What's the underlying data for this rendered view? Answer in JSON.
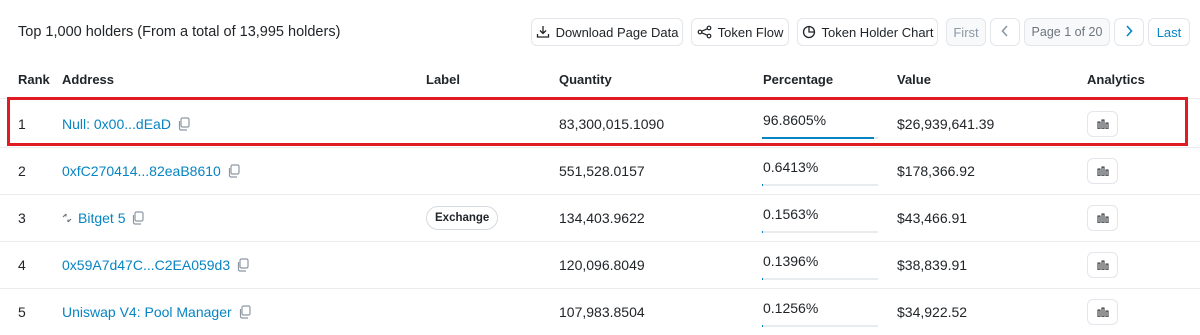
{
  "summary": "Top 1,000 holders (From a total of 13,995 holders)",
  "toolbar": {
    "download_label": "Download Page Data",
    "token_flow_label": "Token Flow",
    "holder_chart_label": "Token Holder Chart",
    "first_label": "First",
    "page_label": "Page 1 of 20",
    "last_label": "Last"
  },
  "columns": {
    "rank": "Rank",
    "address": "Address",
    "label": "Label",
    "quantity": "Quantity",
    "percentage": "Percentage",
    "value": "Value",
    "analytics": "Analytics"
  },
  "rows": [
    {
      "rank": "1",
      "address": "Null: 0x00...dEaD",
      "label": "",
      "quantity": "83,300,015.1090",
      "percentage": "96.8605%",
      "pct_value": 96.8605,
      "value": "$26,939,641.39"
    },
    {
      "rank": "2",
      "address": "0xfC270414...82eaB8610",
      "label": "",
      "quantity": "551,528.0157",
      "percentage": "0.6413%",
      "pct_value": 0.6413,
      "value": "$178,366.92"
    },
    {
      "rank": "3",
      "address": "Bitget 5",
      "label": "Exchange",
      "quantity": "134,403.9622",
      "percentage": "0.1563%",
      "pct_value": 0.1563,
      "value": "$43,466.91"
    },
    {
      "rank": "4",
      "address": "0x59A7d47C...C2EA059d3",
      "label": "",
      "quantity": "120,096.8049",
      "percentage": "0.1396%",
      "pct_value": 0.1396,
      "value": "$38,839.91"
    },
    {
      "rank": "5",
      "address": "Uniswap V4: Pool Manager",
      "label": "",
      "quantity": "107,983.8504",
      "percentage": "0.1256%",
      "pct_value": 0.1256,
      "value": "$34,922.52"
    }
  ],
  "colors": {
    "link": "#0784c3",
    "highlight": "#e01b22",
    "progress": "#0784c3"
  },
  "icons": {
    "download": "download-icon",
    "token_flow": "network-icon",
    "holder_chart": "pie-chart-icon",
    "copy": "copy-icon",
    "analytics": "bar-chart-icon",
    "exchange": "exchange-icon"
  }
}
